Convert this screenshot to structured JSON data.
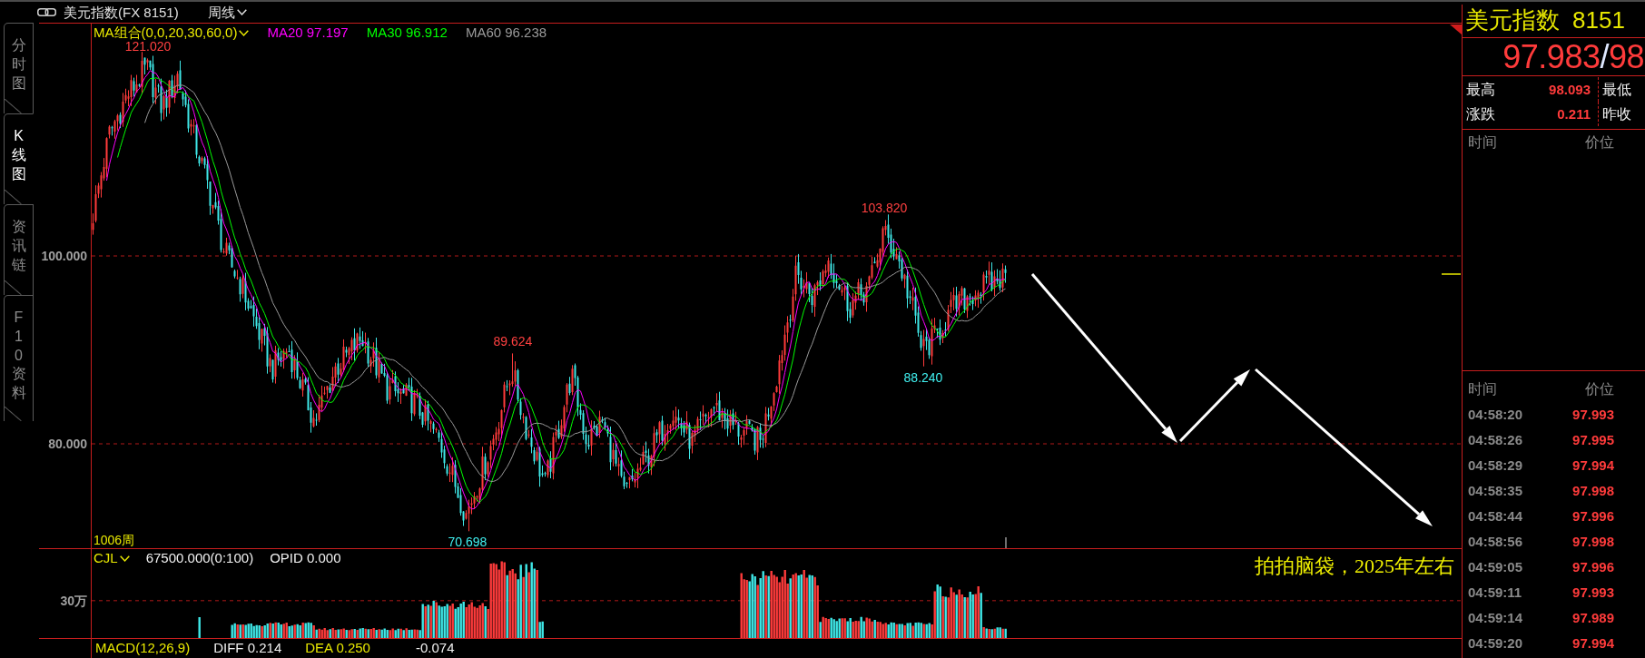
{
  "toolbar": {
    "title": "美元指数(FX 8151)",
    "period": "周线"
  },
  "side_tabs": [
    {
      "label": "分时图",
      "selected": false
    },
    {
      "label": "K线图",
      "selected": true
    },
    {
      "label": "资讯链",
      "selected": false
    },
    {
      "label": "F10资料",
      "selected": false
    }
  ],
  "price_chart": {
    "legend": {
      "indicator": "MA组合(0,0,20,30,60,0)",
      "lines": [
        {
          "label": "MA20 97.197",
          "color": "#ff00ff"
        },
        {
          "label": "MA30 96.912",
          "color": "#00ff00"
        },
        {
          "label": "MA60 96.238",
          "color": "#9a9a9a"
        }
      ]
    },
    "y_labels": [
      "100.000",
      "80.000"
    ],
    "price_marks": [
      {
        "label": "121.020",
        "kind": "high"
      },
      {
        "label": "70.698",
        "kind": "low"
      },
      {
        "label": "89.624",
        "kind": "high"
      },
      {
        "label": "103.820",
        "kind": "high"
      },
      {
        "label": "88.240",
        "kind": "low"
      }
    ],
    "bar_count": "1006周"
  },
  "volume_panel": {
    "indicator": "CJL",
    "value": "67500.000(0:100)",
    "opid": "OPID 0.000",
    "y_label": "30万",
    "note": "拍拍脑袋，2025年左右"
  },
  "macd": {
    "indicator": "MACD(12,26,9)",
    "diff": "DIFF 0.214",
    "dea": "DEA 0.250",
    "value": "-0.074"
  },
  "quote": {
    "name": "美元指数",
    "code": "8151",
    "price": "97.983",
    "separator": "/",
    "price_2": "98",
    "stats": [
      {
        "label": "最高",
        "value": "98.093"
      },
      {
        "label": "最低"
      },
      {
        "label": "涨跌",
        "value": "0.211"
      },
      {
        "label": "昨收"
      }
    ]
  },
  "trades": {
    "columns": [
      "时间",
      "价位"
    ]
  },
  "ticks": {
    "columns": [
      "时间",
      "价位"
    ],
    "rows": [
      {
        "time": "04:58:20",
        "price": "97.993"
      },
      {
        "time": "04:58:26",
        "price": "97.995"
      },
      {
        "time": "04:58:29",
        "price": "97.994"
      },
      {
        "time": "04:58:35",
        "price": "97.998"
      },
      {
        "time": "04:58:44",
        "price": "97.996"
      },
      {
        "time": "04:58:56",
        "price": "97.998"
      },
      {
        "time": "04:59:05",
        "price": "97.996"
      },
      {
        "time": "04:59:11",
        "price": "97.993"
      },
      {
        "time": "04:59:14",
        "price": "97.989"
      },
      {
        "time": "04:59:20",
        "price": "97.994"
      }
    ]
  }
}
